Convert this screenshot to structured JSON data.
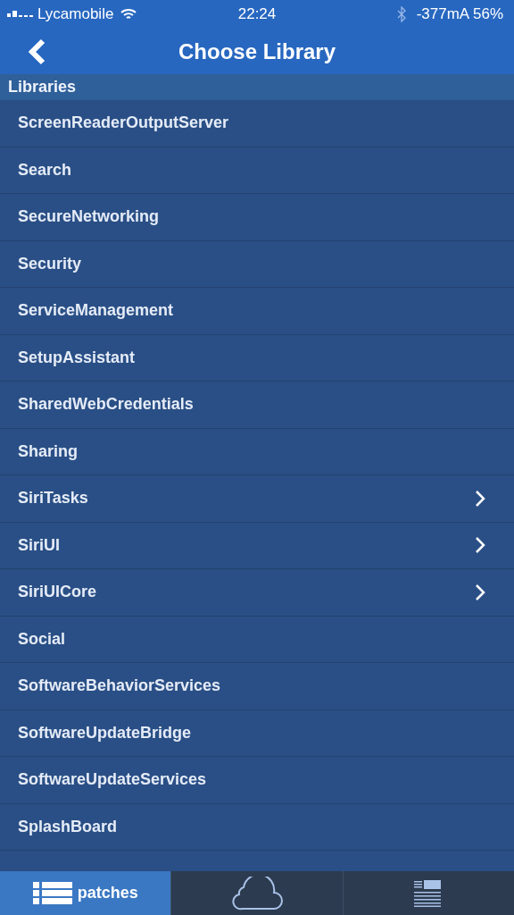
{
  "status_bar": {
    "carrier": "Lycamobile",
    "time": "22:24",
    "battery": "-377mA 56%"
  },
  "nav": {
    "title": "Choose Library"
  },
  "section": {
    "title": "Libraries"
  },
  "items": [
    {
      "label": "ScreenReaderOutputServer",
      "has_children": false
    },
    {
      "label": "Search",
      "has_children": false
    },
    {
      "label": "SecureNetworking",
      "has_children": false
    },
    {
      "label": "Security",
      "has_children": false
    },
    {
      "label": "ServiceManagement",
      "has_children": false
    },
    {
      "label": "SetupAssistant",
      "has_children": false
    },
    {
      "label": "SharedWebCredentials",
      "has_children": false
    },
    {
      "label": "Sharing",
      "has_children": false
    },
    {
      "label": "SiriTasks",
      "has_children": true
    },
    {
      "label": "SiriUI",
      "has_children": true
    },
    {
      "label": "SiriUICore",
      "has_children": true
    },
    {
      "label": "Social",
      "has_children": false
    },
    {
      "label": "SoftwareBehaviorServices",
      "has_children": false
    },
    {
      "label": "SoftwareUpdateBridge",
      "has_children": false
    },
    {
      "label": "SoftwareUpdateServices",
      "has_children": false
    },
    {
      "label": "SplashBoard",
      "has_children": false
    }
  ],
  "tabs": [
    {
      "kind": "list",
      "label": "patches",
      "selected": true
    },
    {
      "kind": "cloud",
      "selected": false
    },
    {
      "kind": "document",
      "selected": false
    }
  ]
}
